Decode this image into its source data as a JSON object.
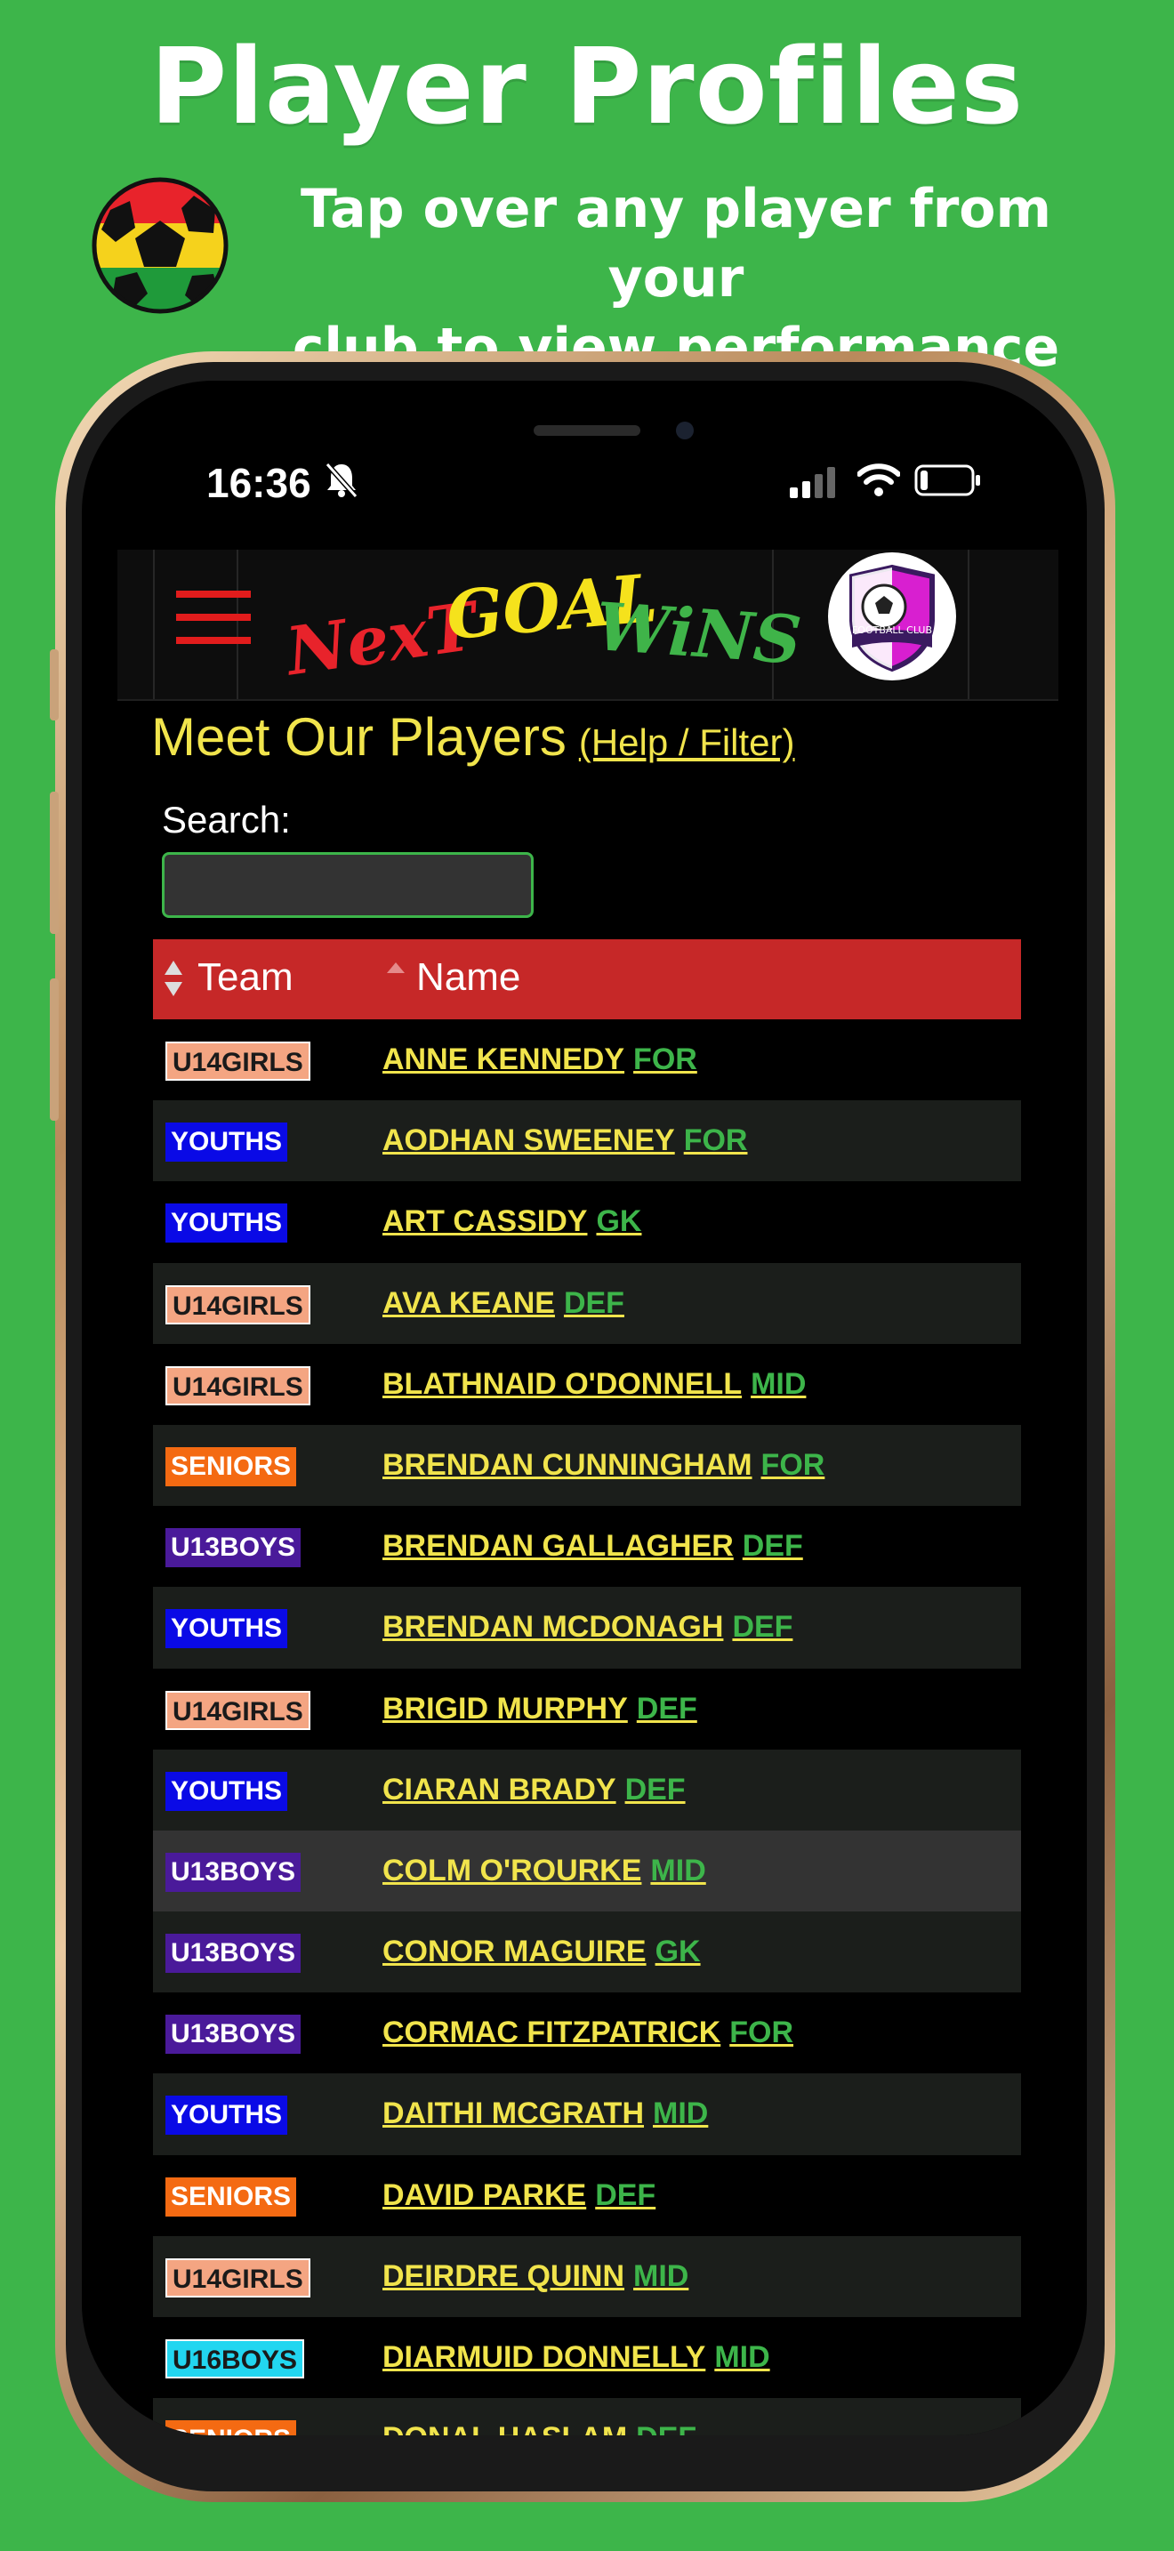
{
  "promo": {
    "title": "Player Profiles",
    "subtitle_line1": "Tap over any player from your",
    "subtitle_line2": "club to view performance stats."
  },
  "status_bar": {
    "time": "16:36"
  },
  "app": {
    "logo_word1": "NexT",
    "logo_word2": "GOAL",
    "logo_word3": "WiNS",
    "club_badge_text": "FOOTBALL CLUB"
  },
  "page": {
    "title": "Meet Our Players",
    "help_link": "(Help / Filter)",
    "search_label": "Search:",
    "search_value": ""
  },
  "table": {
    "col_team": "Team",
    "col_name": "Name",
    "rows": [
      {
        "team": "U14GIRLS",
        "name": "ANNE KENNEDY",
        "pos": "FOR"
      },
      {
        "team": "YOUTHS",
        "name": "AODHAN SWEENEY",
        "pos": "FOR"
      },
      {
        "team": "YOUTHS",
        "name": "ART CASSIDY",
        "pos": "GK"
      },
      {
        "team": "U14GIRLS",
        "name": "AVA KEANE",
        "pos": "DEF"
      },
      {
        "team": "U14GIRLS",
        "name": "BLATHNAID O'DONNELL",
        "pos": "MID"
      },
      {
        "team": "SENIORS",
        "name": "BRENDAN CUNNINGHAM",
        "pos": "FOR"
      },
      {
        "team": "U13BOYS",
        "name": "BRENDAN GALLAGHER",
        "pos": "DEF"
      },
      {
        "team": "YOUTHS",
        "name": "BRENDAN MCDONAGH",
        "pos": "DEF"
      },
      {
        "team": "U14GIRLS",
        "name": "BRIGID MURPHY",
        "pos": "DEF"
      },
      {
        "team": "YOUTHS",
        "name": "CIARAN BRADY",
        "pos": "DEF"
      },
      {
        "team": "U13BOYS",
        "name": "COLM O'ROURKE",
        "pos": "MID"
      },
      {
        "team": "U13BOYS",
        "name": "CONOR MAGUIRE",
        "pos": "GK"
      },
      {
        "team": "U13BOYS",
        "name": "CORMAC FITZPATRICK",
        "pos": "FOR"
      },
      {
        "team": "YOUTHS",
        "name": "DAITHI MCGRATH",
        "pos": "MID"
      },
      {
        "team": "SENIORS",
        "name": "DAVID PARKE",
        "pos": "DEF"
      },
      {
        "team": "U14GIRLS",
        "name": "DEIRDRE QUINN",
        "pos": "MID"
      },
      {
        "team": "U16BOYS",
        "name": "DIARMUID DONNELLY",
        "pos": "MID"
      },
      {
        "team": "SENIORS",
        "name": "DONAL HASLAM",
        "pos": "DEF"
      }
    ]
  },
  "team_colors": {
    "U14GIRLS": {
      "bg": "#f4a582",
      "fg": "#1a1a1a"
    },
    "YOUTHS": {
      "bg": "#0a0ae6",
      "fg": "#ffffff"
    },
    "SENIORS": {
      "bg": "#f46a12",
      "fg": "#ffffff"
    },
    "U13BOYS": {
      "bg": "#4a1a9a",
      "fg": "#ffffff"
    },
    "U16BOYS": {
      "bg": "#22d6f0",
      "fg": "#1a1a1a"
    }
  },
  "highlighted_row": "COLM O'ROURKE",
  "colors": {
    "background": "#3db54a",
    "accent_yellow": "#f1e44c",
    "header_red": "#c62828",
    "position_green": "#3db54a"
  },
  "icons": [
    "menu-icon",
    "bell-slash-icon",
    "signal-icon",
    "wifi-icon",
    "battery-icon",
    "football-icon",
    "club-badge-icon",
    "sort-icon"
  ]
}
